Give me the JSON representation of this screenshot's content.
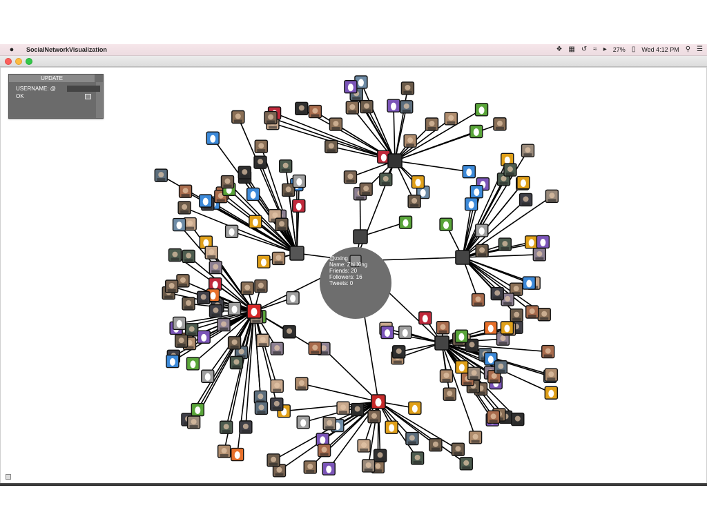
{
  "menubar": {
    "app_name": "SocialNetworkVisualization",
    "battery": "27%",
    "clock": "Wed 4:12 PM"
  },
  "panel": {
    "title": "UPDATE",
    "username_label": "USERNAME: @",
    "username_value": "",
    "ok_label": "OK"
  },
  "info": {
    "handle": "@zxing",
    "name": "Name: Zhi Xing",
    "friends": "Friends: 20",
    "followers": "Followers: 16",
    "tweets": "Tweets: 0"
  },
  "network": {
    "hub_colors": [
      "#d62929",
      "#c62b2b",
      "#444444"
    ],
    "egg_colors": [
      "#6d8ba6",
      "#e0a019",
      "#5aa53a",
      "#c0293b",
      "#3d8ad9",
      "#e7702b",
      "#7b55b8",
      "#a0a0a0"
    ],
    "photo_colors": [
      "#6b5b4a",
      "#8a6f56",
      "#3f3f47",
      "#b08d6e",
      "#5c6e7d",
      "#9a8a7b",
      "#2f2f2f",
      "#7a6452",
      "#c9a98d",
      "#4d5c4f",
      "#8c7f91",
      "#a86b4c"
    ]
  }
}
